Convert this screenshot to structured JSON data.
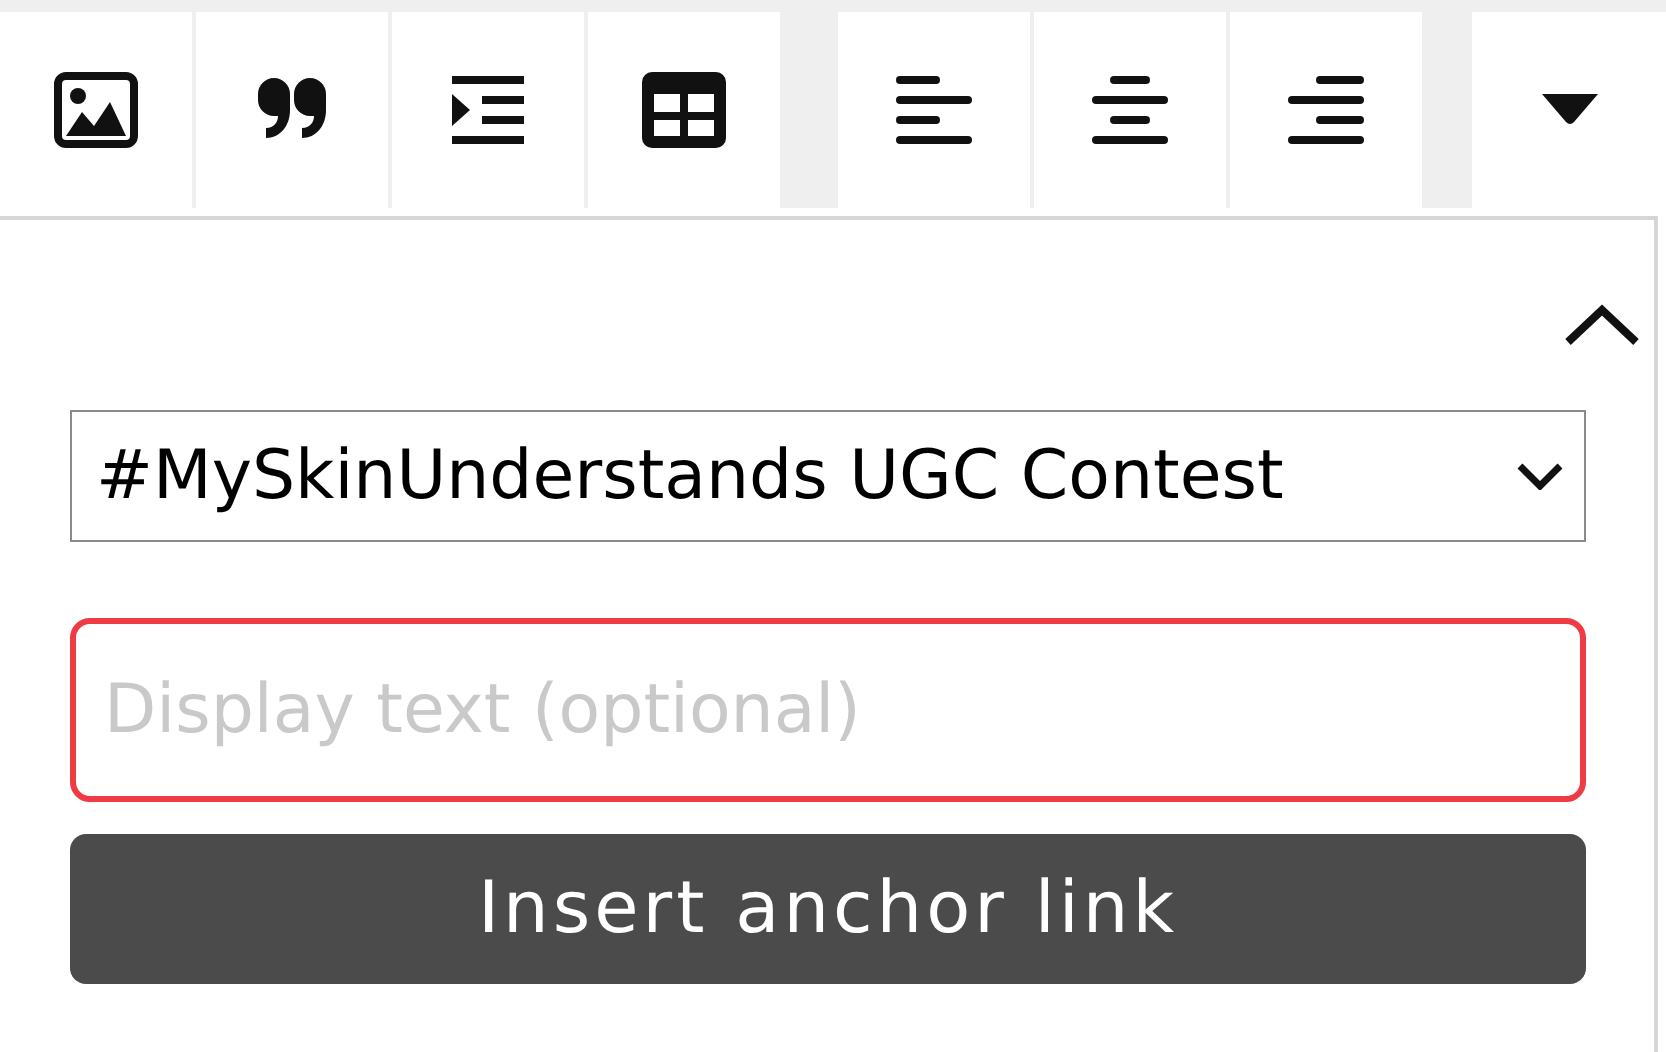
{
  "anchor_panel": {
    "collapsed": false,
    "section_select": {
      "value": "#MySkinUnderstands UGC Contest"
    },
    "display_text": {
      "placeholder": "Display text (optional)",
      "invalid": true
    },
    "insert_button": {
      "label": "Insert anchor link"
    }
  }
}
